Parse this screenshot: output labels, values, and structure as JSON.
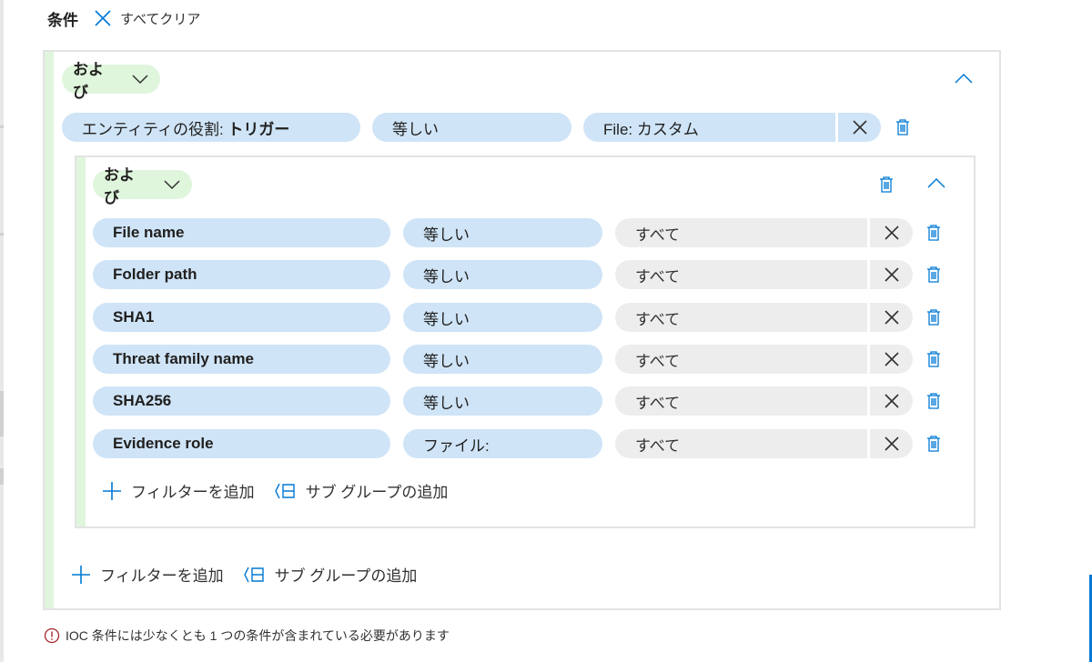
{
  "header": {
    "title": "条件",
    "clear_all": "すべてクリア"
  },
  "outer_group": {
    "operator": "および",
    "condition": {
      "field_prefix": "エンティティの役割: ",
      "field_value": "トリガー",
      "operator": "等しい",
      "value": "File: カスタム"
    },
    "add_filter": "フィルターを追加",
    "add_subgroup": "サブ グループの追加"
  },
  "inner_group": {
    "operator": "および",
    "conditions": [
      {
        "field": "File name",
        "operator": "等しい",
        "value": "すべて"
      },
      {
        "field": "Folder path",
        "operator": "等しい",
        "value": "すべて"
      },
      {
        "field": "SHA1",
        "operator": "等しい",
        "value": "すべて"
      },
      {
        "field": "Threat family name",
        "operator": "等しい",
        "value": "すべて"
      },
      {
        "field": "SHA256",
        "operator": "等しい",
        "value": "すべて"
      },
      {
        "field": "Evidence role",
        "operator": "ファイル:",
        "value": "すべて"
      }
    ],
    "add_filter": "フィルターを追加",
    "add_subgroup": "サブ グループの追加"
  },
  "error_message": "IOC 条件には少なくとも 1 つの条件が含まれている必要があります",
  "colors": {
    "accent_blue": "#0078d4",
    "pill_blue": "#cfe4f7",
    "pill_gray": "#ededed",
    "group_green": "#dff6dd",
    "error_red": "#a4262c"
  },
  "icons": {
    "clear": "close-icon",
    "dropdown": "chevron-down-icon",
    "collapse": "chevron-up-icon",
    "delete": "trash-icon",
    "remove": "close-icon",
    "add": "plus-icon",
    "subgroup": "subgroup-icon",
    "error": "error-circle-icon"
  }
}
